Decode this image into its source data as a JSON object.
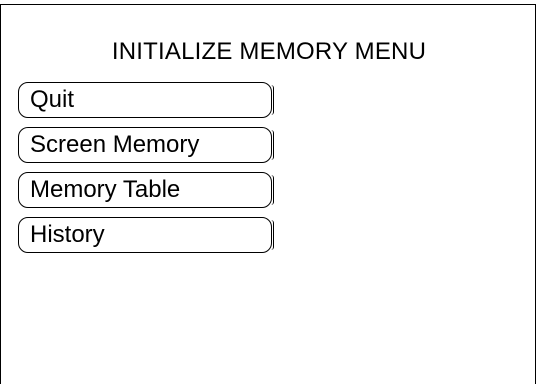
{
  "menu": {
    "title": "INITIALIZE MEMORY MENU",
    "items": [
      {
        "label": "Quit"
      },
      {
        "label": "Screen Memory"
      },
      {
        "label": "Memory Table"
      },
      {
        "label": "History"
      }
    ]
  },
  "colors": {
    "background": "#ffffff",
    "foreground": "#000000"
  }
}
